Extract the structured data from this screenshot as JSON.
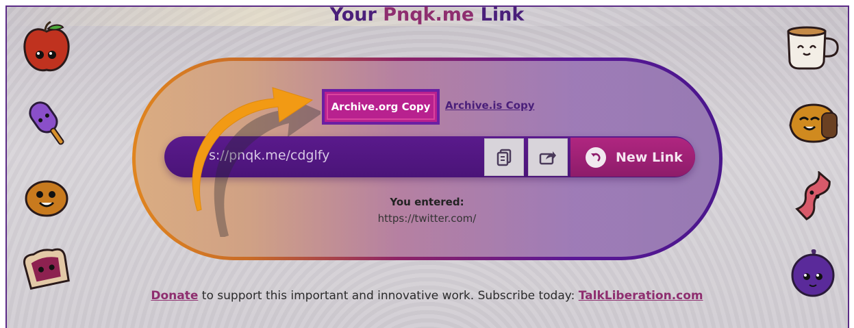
{
  "header": {
    "title_prefix": "Your ",
    "title_brand": "Pnqk.me",
    "title_suffix": " Link"
  },
  "archive": {
    "org_label": "Archive.org Copy",
    "is_label": "Archive.is Copy"
  },
  "link": {
    "short_url": "s://pnqk.me/cdglfy",
    "new_link_label": "New Link"
  },
  "entered": {
    "label": "You entered:",
    "value": "https://twitter.com/"
  },
  "footer": {
    "donate_label": "Donate",
    "middle_text": " to support this important and innovative work. Subscribe today: ",
    "talk_label": "TalkLiberation.com"
  },
  "icons": {
    "copy": "copy-icon",
    "share": "share-icon",
    "refresh": "undo-icon",
    "arrow": "orange-arrow"
  },
  "colors": {
    "brand_purple": "#4a1f7a",
    "brand_magenta": "#b8218f",
    "accent_orange": "#f29a14"
  }
}
